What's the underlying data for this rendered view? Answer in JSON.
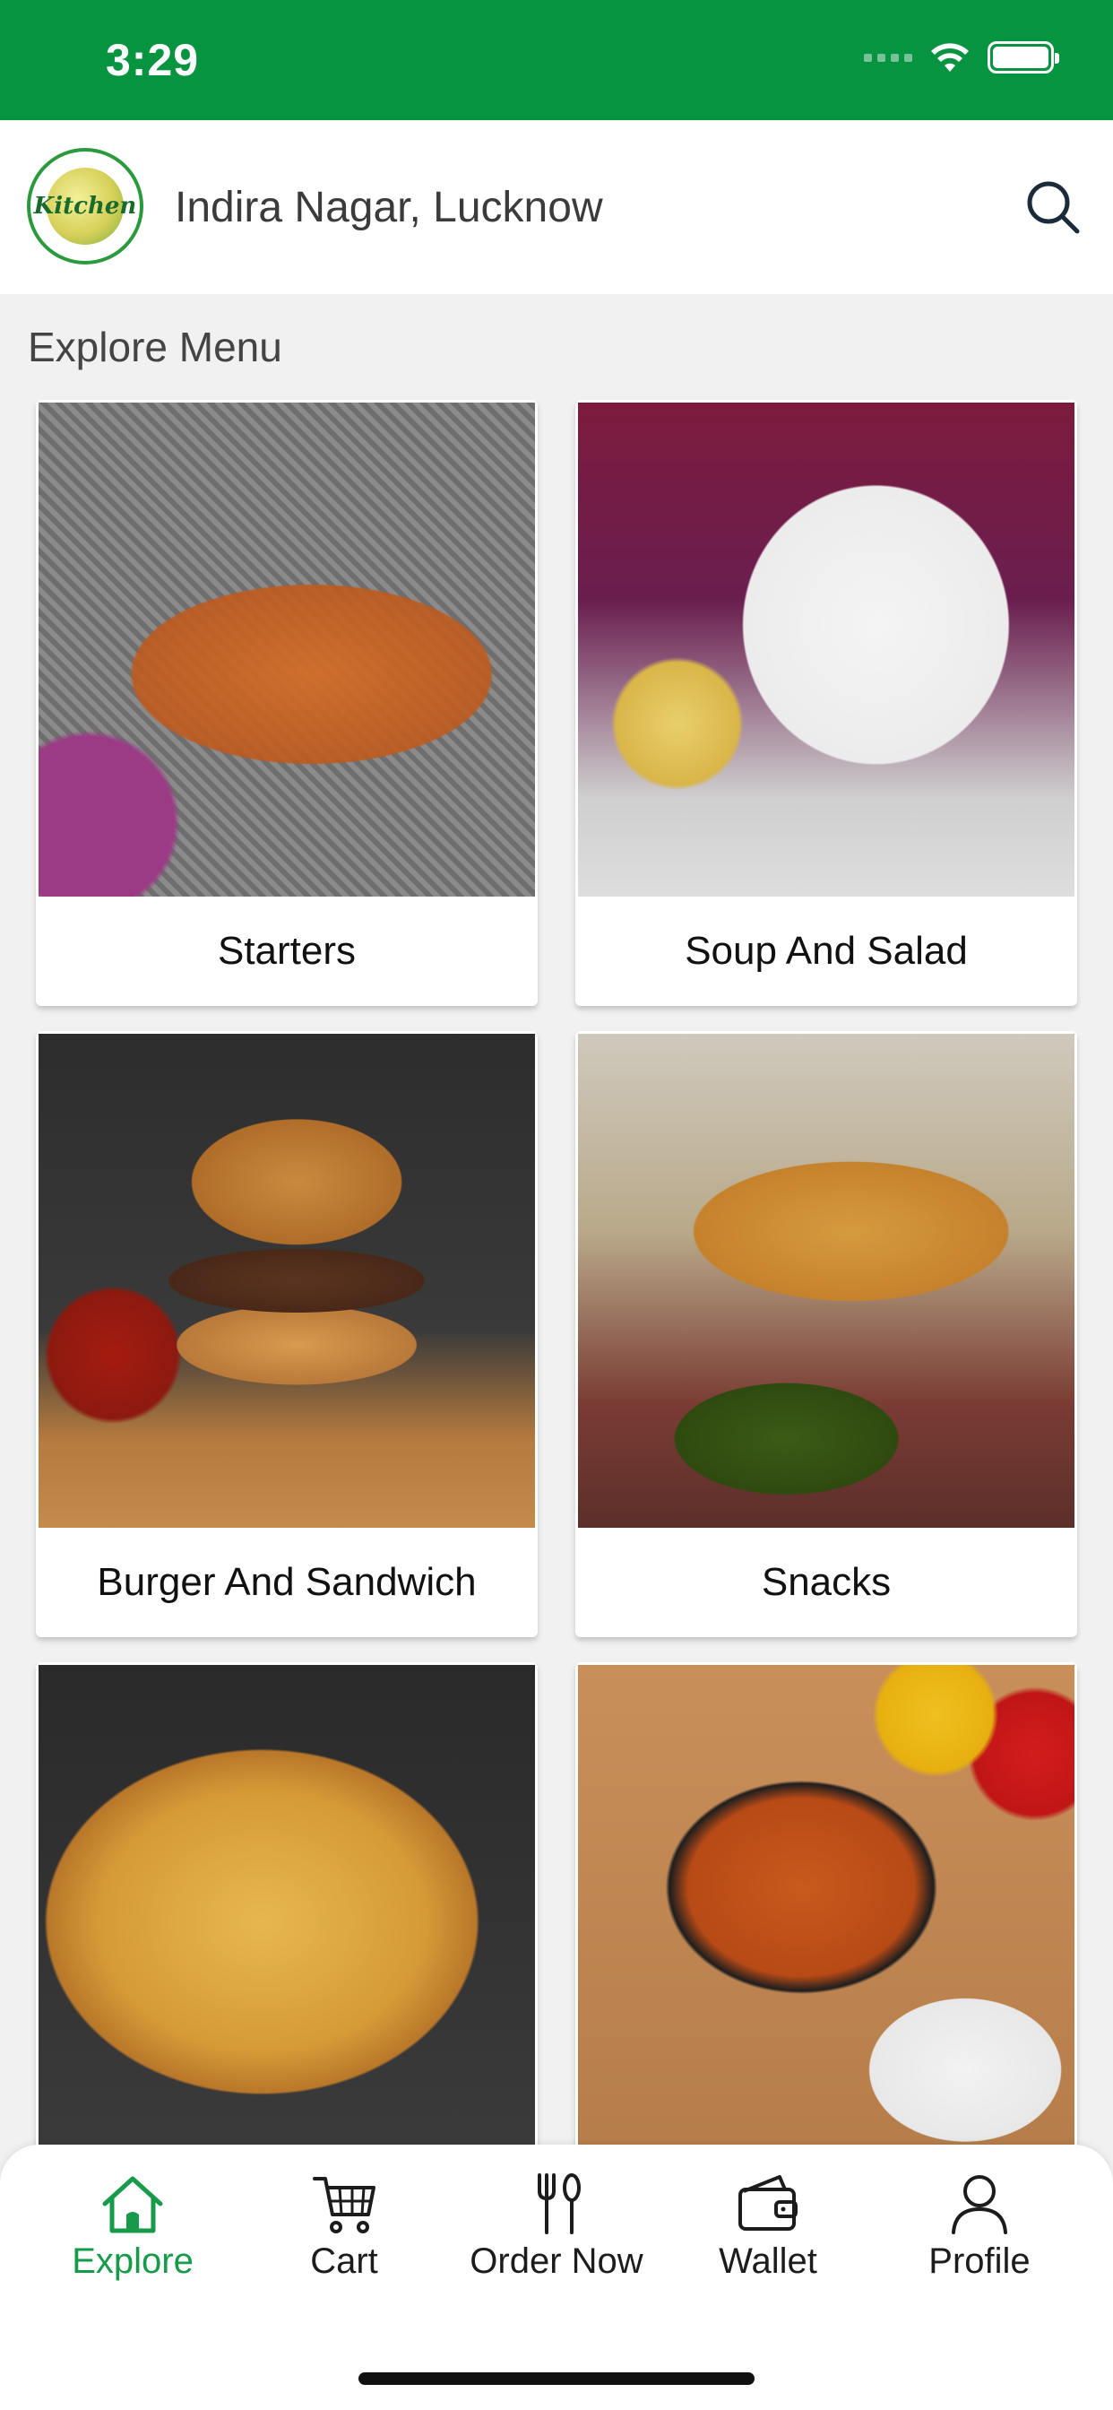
{
  "status_bar": {
    "time": "3:29"
  },
  "header": {
    "logo_text": "Kitchen",
    "location": "Indira Nagar, Lucknow"
  },
  "section_title": "Explore Menu",
  "menu": {
    "items": [
      {
        "label": "Starters"
      },
      {
        "label": "Soup And Salad"
      },
      {
        "label": "Burger And Sandwich"
      },
      {
        "label": "Snacks"
      },
      {
        "label": ""
      },
      {
        "label": ""
      }
    ]
  },
  "tabs": [
    {
      "label": "Explore",
      "icon": "home-icon",
      "active": true
    },
    {
      "label": "Cart",
      "icon": "cart-icon",
      "active": false
    },
    {
      "label": "Order Now",
      "icon": "fork-spoon-icon",
      "active": false
    },
    {
      "label": "Wallet",
      "icon": "wallet-icon",
      "active": false
    },
    {
      "label": "Profile",
      "icon": "user-icon",
      "active": false
    }
  ],
  "colors": {
    "brand_green": "#079441",
    "active_tab": "#179a4a"
  }
}
